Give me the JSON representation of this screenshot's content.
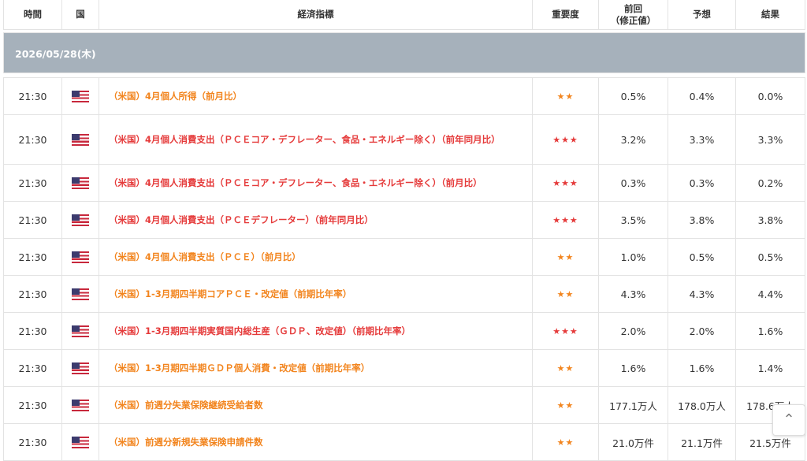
{
  "header": {
    "time": "時間",
    "country": "国",
    "indicator": "経済指標",
    "importance": "重要度",
    "previous_line1": "前回",
    "previous_line2": "（修正値）",
    "forecast": "予想",
    "result": "結果"
  },
  "date": "2026/05/28(木)",
  "colors": {
    "high": "#e53a3a",
    "medium": "#f2841d",
    "date_bar": "#a6b1bb"
  },
  "rows": [
    {
      "time": "21:30",
      "flag": "us-flag-icon",
      "name": "（米国）4月個人所得（前月比）",
      "stars": "★★",
      "previous": "0.5%",
      "forecast": "0.4%",
      "result": "0.0%"
    },
    {
      "time": "21:30",
      "flag": "us-flag-icon",
      "name": "（米国）4月個人消費支出（ＰＣＥコア・デフレーター、食品・エネルギー除く）（前年同月比）",
      "stars": "★★★",
      "previous": "3.2%",
      "forecast": "3.3%",
      "result": "3.3%"
    },
    {
      "time": "21:30",
      "flag": "us-flag-icon",
      "name": "（米国）4月個人消費支出（ＰＣＥコア・デフレーター、食品・エネルギー除く）（前月比）",
      "stars": "★★★",
      "previous": "0.3%",
      "forecast": "0.3%",
      "result": "0.2%"
    },
    {
      "time": "21:30",
      "flag": "us-flag-icon",
      "name": "（米国）4月個人消費支出（ＰＣＥデフレーター）（前年同月比）",
      "stars": "★★★",
      "previous": "3.5%",
      "forecast": "3.8%",
      "result": "3.8%"
    },
    {
      "time": "21:30",
      "flag": "us-flag-icon",
      "name": "（米国）4月個人消費支出（ＰＣＥ）（前月比）",
      "stars": "★★",
      "previous": "1.0%",
      "forecast": "0.5%",
      "result": "0.5%"
    },
    {
      "time": "21:30",
      "flag": "us-flag-icon",
      "name": "（米国）1-3月期四半期コアＰＣＥ・改定値（前期比年率）",
      "stars": "★★",
      "previous": "4.3%",
      "forecast": "4.3%",
      "result": "4.4%"
    },
    {
      "time": "21:30",
      "flag": "us-flag-icon",
      "name": "（米国）1-3月期四半期実質国内総生産（ＧＤＰ、改定値）（前期比年率）",
      "stars": "★★★",
      "previous": "2.0%",
      "forecast": "2.0%",
      "result": "1.6%"
    },
    {
      "time": "21:30",
      "flag": "us-flag-icon",
      "name": "（米国）1-3月期四半期ＧＤＰ個人消費・改定値（前期比年率）",
      "stars": "★★",
      "previous": "1.6%",
      "forecast": "1.6%",
      "result": "1.4%"
    },
    {
      "time": "21:30",
      "flag": "us-flag-icon",
      "name": "（米国）前週分失業保険継続受給者数",
      "stars": "★★",
      "previous": "177.1万人",
      "forecast": "178.0万人",
      "result": "178.6万人"
    },
    {
      "time": "21:30",
      "flag": "us-flag-icon",
      "name": "（米国）前週分新規失業保険申請件数",
      "stars": "★★",
      "previous": "21.0万件",
      "forecast": "21.1万件",
      "result": "21.5万件"
    }
  ],
  "scroll_top_icon": "chevron-up-icon",
  "scroll_top_glyph": "⌃"
}
